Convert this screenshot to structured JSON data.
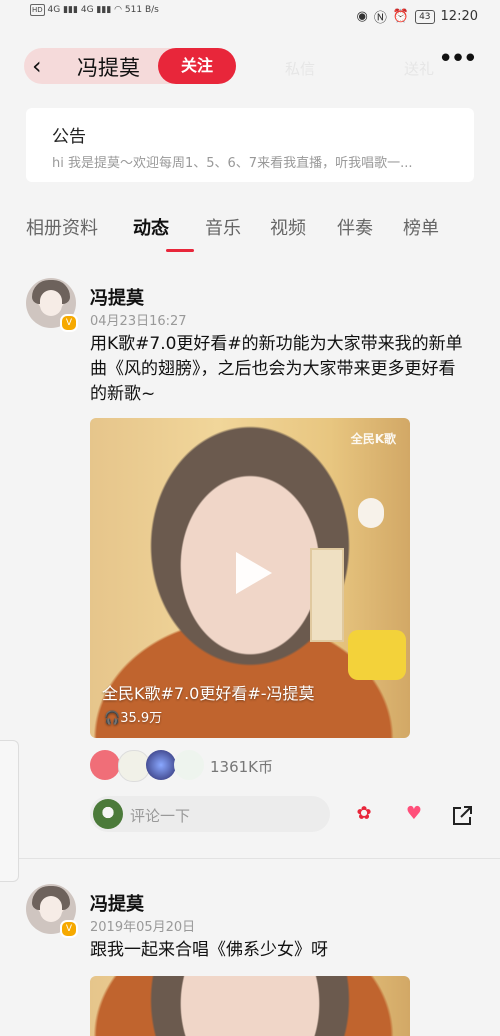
{
  "status_bar": {
    "net_speed": "511",
    "net_unit": "B/s",
    "signal_1": "4G",
    "signal_2": "4G",
    "battery": "43",
    "time": "12:20"
  },
  "header": {
    "name": "冯提莫",
    "follow_label": "关注",
    "ghost_1": "私信",
    "ghost_2": "送礼"
  },
  "notice": {
    "title": "公告",
    "text": "hi 我是提莫～欢迎每周1、5、6、7来看我直播，听我唱歌一..."
  },
  "tabs": [
    "相册资料",
    "动态",
    "音乐",
    "视频",
    "伴奏",
    "榜单"
  ],
  "active_tab": 1,
  "posts": [
    {
      "author": "冯提莫",
      "date": "04月23日16:27",
      "text": "用K歌#7.0更好看#的新功能为大家带来我的新单曲《风的翅膀》，之后也会为大家带来更多更好看的新歌~",
      "video": {
        "watermark": "全民K歌",
        "title": "全民K歌#7.0更好看#-冯提莫",
        "plays": "35.9万"
      },
      "coins": "1361K币",
      "comment_placeholder": "评论一下"
    },
    {
      "author": "冯提莫",
      "date": "2019年05月20日",
      "text": "跟我一起来合唱《佛系少女》呀"
    }
  ],
  "colors": {
    "accent": "#e8263a",
    "badge": "#f6a900"
  }
}
